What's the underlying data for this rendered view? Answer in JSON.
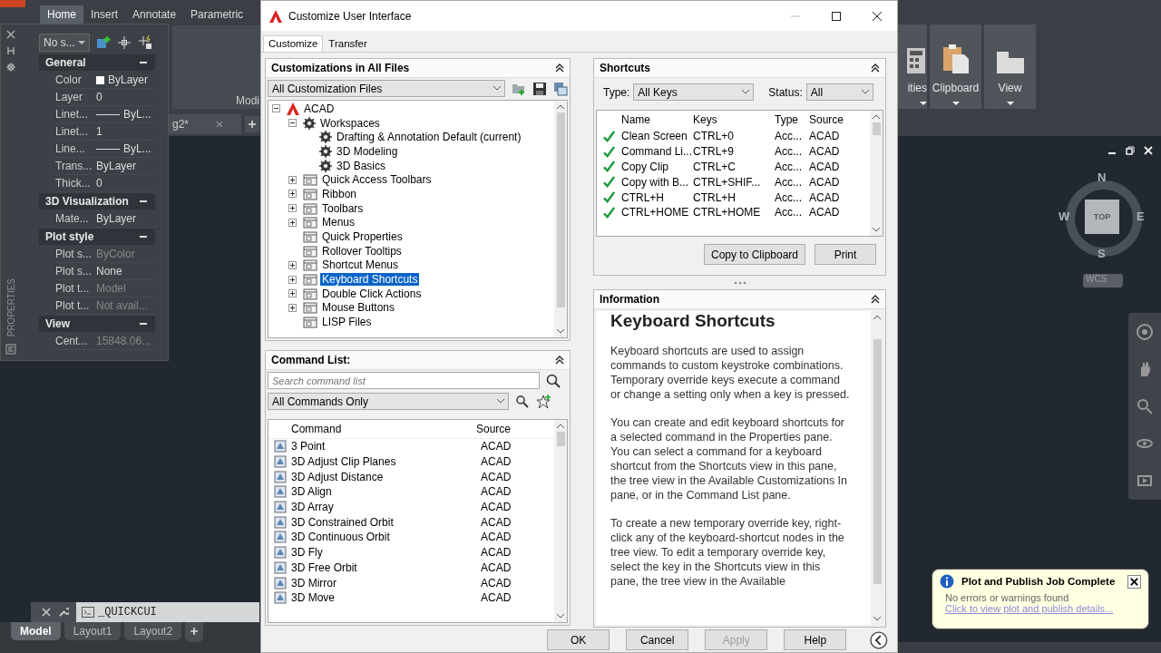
{
  "app": {
    "ribbon_tabs": [
      {
        "label": "Home",
        "selected": true
      },
      {
        "label": "Insert",
        "selected": false
      },
      {
        "label": "Annotate",
        "selected": false
      },
      {
        "label": "Parametric",
        "selected": false
      }
    ],
    "panel_label": "Modi",
    "doc_tab": "g2*",
    "right_panels": [
      "ities",
      "Clipboard",
      "View"
    ],
    "properties": {
      "side_label": "PROPERTIES",
      "selection": "No s...",
      "sections": [
        {
          "title": "General",
          "expanded": true,
          "rows": [
            {
              "name": "Color",
              "value": "ByLayer",
              "kind": "swatch",
              "disabled": false
            },
            {
              "name": "Layer",
              "value": "0",
              "kind": "text",
              "disabled": false
            },
            {
              "name": "Linet...",
              "value": "ByL...",
              "kind": "line",
              "disabled": false
            },
            {
              "name": "Linet...",
              "value": "1",
              "kind": "text",
              "disabled": false
            },
            {
              "name": "Line...",
              "value": "ByL...",
              "kind": "line",
              "disabled": false
            },
            {
              "name": "Trans...",
              "value": "ByLayer",
              "kind": "text",
              "disabled": false
            },
            {
              "name": "Thick...",
              "value": "0",
              "kind": "text",
              "disabled": false
            }
          ]
        },
        {
          "title": "3D Visualization",
          "expanded": true,
          "rows": [
            {
              "name": "Mate...",
              "value": "ByLayer",
              "kind": "text",
              "disabled": false
            }
          ]
        },
        {
          "title": "Plot style",
          "expanded": true,
          "rows": [
            {
              "name": "Plot s...",
              "value": "ByColor",
              "kind": "text",
              "disabled": true
            },
            {
              "name": "Plot s...",
              "value": "None",
              "kind": "text",
              "disabled": false
            },
            {
              "name": "Plot t...",
              "value": "Model",
              "kind": "text",
              "disabled": true
            },
            {
              "name": "Plot t...",
              "value": "Not avail...",
              "kind": "text",
              "disabled": true
            }
          ]
        },
        {
          "title": "View",
          "expanded": true,
          "rows": [
            {
              "name": "Cent...",
              "value": "15848.06...",
              "kind": "text",
              "disabled": true
            }
          ]
        }
      ]
    },
    "command_line": "_QUICKCUI",
    "layout_tabs": [
      {
        "label": "Model",
        "selected": true
      },
      {
        "label": "Layout1",
        "selected": false
      },
      {
        "label": "Layout2",
        "selected": false
      }
    ],
    "viewcube": {
      "face": "TOP",
      "north": "N",
      "south": "S",
      "east": "E",
      "west": "W",
      "ucs": "WCS"
    },
    "notification": {
      "title": "Plot and Publish Job Complete",
      "message": "No errors or warnings found",
      "link": "Click to view plot and publish details..."
    }
  },
  "dialog": {
    "title": "Customize User Interface",
    "tabs": [
      {
        "label": "Customize",
        "selected": true
      },
      {
        "label": "Transfer",
        "selected": false
      }
    ],
    "customizations": {
      "title": "Customizations in All Files",
      "file": "All Customization Files",
      "tree": [
        {
          "label": "ACAD",
          "expanded": true,
          "selected": false,
          "children": [
            {
              "label": "Workspaces",
              "expanded": true,
              "selected": false,
              "children": [
                {
                  "label": "Drafting & Annotation Default (current)",
                  "selected": false
                },
                {
                  "label": "3D Modeling",
                  "selected": false
                },
                {
                  "label": "3D Basics",
                  "selected": false
                }
              ]
            },
            {
              "label": "Quick Access Toolbars",
              "expanded": false,
              "selected": false
            },
            {
              "label": "Ribbon",
              "expanded": false,
              "selected": false
            },
            {
              "label": "Toolbars",
              "expanded": false,
              "selected": false
            },
            {
              "label": "Menus",
              "expanded": false,
              "selected": false
            },
            {
              "label": "Quick Properties",
              "selected": false
            },
            {
              "label": "Rollover Tooltips",
              "selected": false
            },
            {
              "label": "Shortcut Menus",
              "expanded": false,
              "selected": false
            },
            {
              "label": "Keyboard Shortcuts",
              "expanded": false,
              "selected": true
            },
            {
              "label": "Double Click Actions",
              "expanded": false,
              "selected": false
            },
            {
              "label": "Mouse Buttons",
              "expanded": false,
              "selected": false
            },
            {
              "label": "LISP Files",
              "selected": false
            }
          ]
        }
      ]
    },
    "command_list": {
      "title": "Command List:",
      "placeholder": "Search command list",
      "filter": "All Commands Only",
      "columns": [
        "Command",
        "Source"
      ],
      "rows": [
        [
          "3 Point",
          "ACAD"
        ],
        [
          "3D Adjust Clip Planes",
          "ACAD"
        ],
        [
          "3D Adjust Distance",
          "ACAD"
        ],
        [
          "3D Align",
          "ACAD"
        ],
        [
          "3D Array",
          "ACAD"
        ],
        [
          "3D Constrained Orbit",
          "ACAD"
        ],
        [
          "3D Continuous Orbit",
          "ACAD"
        ],
        [
          "3D Fly",
          "ACAD"
        ],
        [
          "3D Free Orbit",
          "ACAD"
        ],
        [
          "3D Mirror",
          "ACAD"
        ],
        [
          "3D Move",
          "ACAD"
        ]
      ]
    },
    "shortcuts": {
      "title": "Shortcuts",
      "type_label": "Type:",
      "type": "All Keys",
      "status_label": "Status:",
      "status": "All",
      "columns": [
        "Name",
        "Keys",
        "Type",
        "Source"
      ],
      "rows": [
        {
          "valid": true,
          "cells": [
            "Clean Screen",
            "CTRL+0",
            "Acc...",
            "ACAD"
          ]
        },
        {
          "valid": true,
          "cells": [
            "Command Li...",
            "CTRL+9",
            "Acc...",
            "ACAD"
          ]
        },
        {
          "valid": true,
          "cells": [
            "Copy Clip",
            "CTRL+C",
            "Acc...",
            "ACAD"
          ]
        },
        {
          "valid": true,
          "cells": [
            "Copy with B...",
            "CTRL+SHIF...",
            "Acc...",
            "ACAD"
          ]
        },
        {
          "valid": true,
          "cells": [
            "CTRL+H",
            "CTRL+H",
            "Acc...",
            "ACAD"
          ]
        },
        {
          "valid": true,
          "cells": [
            "CTRL+HOME",
            "CTRL+HOME",
            "Acc...",
            "ACAD"
          ]
        }
      ],
      "buttons": [
        "Copy to Clipboard",
        "Print"
      ]
    },
    "information": {
      "title": "Information",
      "heading": "Keyboard Shortcuts",
      "paragraphs": [
        "Keyboard shortcuts are used to assign commands to custom keystroke combinations. Temporary override keys execute a command or change a setting only when a key is pressed.",
        "You can create and edit keyboard shortcuts for a selected command in the Properties pane. You can select a command for a keyboard shortcut from the Shortcuts view in this pane, the tree view in the Available Customizations In pane, or in the Command List pane.",
        "To create a new temporary override key, right-click any of the keyboard-shortcut nodes in the tree view. To edit a temporary override key, select the key in the Shortcuts view in this pane, the tree view in the Available"
      ]
    },
    "buttons": [
      {
        "label": "OK",
        "disabled": false
      },
      {
        "label": "Cancel",
        "disabled": false
      },
      {
        "label": "Apply",
        "disabled": true
      },
      {
        "label": "Help",
        "disabled": false
      }
    ]
  }
}
